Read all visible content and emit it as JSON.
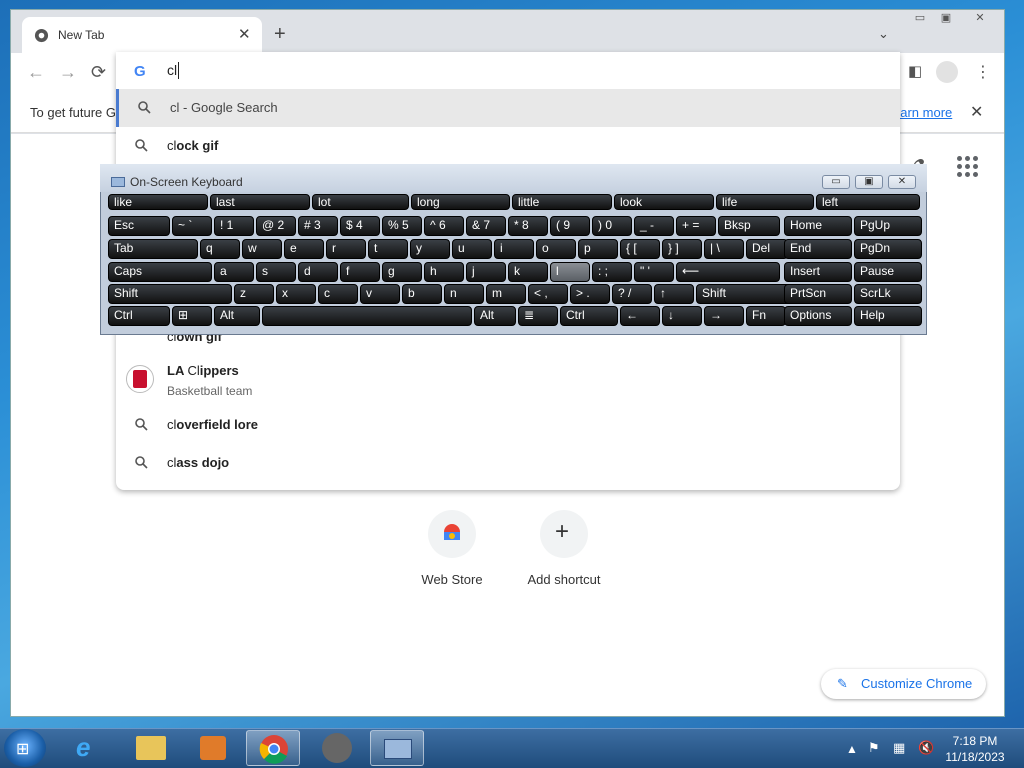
{
  "browser": {
    "tab_title": "New Tab",
    "window_buttons": [
      "▭",
      "▣",
      "✕"
    ],
    "new_tab_symbol": "+",
    "tab_search_symbol": "⌄",
    "nav": {
      "back": "←",
      "forward": "→",
      "reload": "⟳"
    }
  },
  "omnibox": {
    "typed_text": "cl",
    "suggestions": [
      {
        "prefix": "cl",
        "rest": " - Google Search",
        "icon": "search-icon"
      },
      {
        "prefix": "cl",
        "rest": "ock gif",
        "icon": "search-icon"
      },
      {
        "prefix": "cl",
        "rest": "own gif",
        "icon": "search-icon"
      },
      {
        "prefix": "cl",
        "rest": "overfield lore",
        "icon": "search-icon"
      },
      {
        "prefix": "cl",
        "rest": "ass dojo",
        "icon": "search-icon"
      }
    ],
    "entity": {
      "title_prefix": "LA ",
      "title_bold": "Cl",
      "title_rest": "ippers",
      "subtitle": "Basketball team"
    }
  },
  "infobar": {
    "text": "To get future G",
    "learn_more": "earn more",
    "close": "✕"
  },
  "ntp": {
    "shortcuts": [
      {
        "label": "Web Store",
        "icon": "web-store-icon"
      },
      {
        "label": "Add shortcut",
        "icon": "plus-icon"
      }
    ],
    "customize_label": "Customize Chrome"
  },
  "osk": {
    "title": "On-Screen Keyboard",
    "predictions": [
      "like",
      "last",
      "lot",
      "long",
      "little",
      "look",
      "life",
      "left"
    ],
    "rows": [
      [
        "Esc",
        "~ `",
        "! 1",
        "@ 2",
        "# 3",
        "$ 4",
        "% 5",
        "^ 6",
        "& 7",
        "* 8",
        "( 9",
        ") 0",
        "_ -",
        "+ =",
        "Bksp",
        "Home",
        "PgUp"
      ],
      [
        "Tab",
        "q",
        "w",
        "e",
        "r",
        "t",
        "y",
        "u",
        "i",
        "o",
        "p",
        "{ [",
        "} ]",
        "| \\",
        "Del",
        "End",
        "PgDn"
      ],
      [
        "Caps",
        "a",
        "s",
        "d",
        "f",
        "g",
        "h",
        "j",
        "k",
        "l",
        ": ;",
        "\" '",
        "⟵",
        "Insert",
        "Pause"
      ],
      [
        "Shift",
        "z",
        "x",
        "c",
        "v",
        "b",
        "n",
        "m",
        "< ,",
        "> .",
        "? /",
        "↑",
        "Shift",
        "PrtScn",
        "ScrLk"
      ],
      [
        "Ctrl",
        "⊞",
        "Alt",
        "",
        "Alt",
        "≣",
        "Ctrl",
        "←",
        "↓",
        "→",
        "Fn",
        "Options",
        "Help"
      ]
    ]
  },
  "taskbar": {
    "time": "7:18 PM",
    "date": "11/18/2023",
    "tray_symbol": "▲"
  }
}
